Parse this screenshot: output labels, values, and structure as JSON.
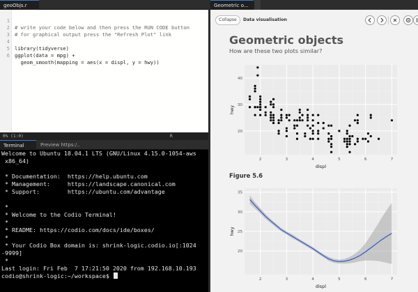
{
  "editor": {
    "tab_label": "geoObjs.r",
    "lines": [
      {
        "n": "1",
        "text": "# write your code below and then press the RUN CODE button",
        "type": "comment"
      },
      {
        "n": "2",
        "text": "# for graphical output press the \"Refresh Plot\" link",
        "type": "comment"
      },
      {
        "n": "3",
        "text": "",
        "type": "code"
      },
      {
        "n": "4",
        "text": "library(tidyverse)",
        "type": "code"
      },
      {
        "n": "5",
        "text": "ggplot(data = mpg) +",
        "type": "code"
      },
      {
        "n": "6",
        "text": "  geom_smooth(mapping = aes(x = displ, y = hwy))",
        "type": "code"
      }
    ],
    "status_left": "0% (1:0)",
    "status_lang": "R"
  },
  "terminal": {
    "tabs": [
      "Terminal",
      "Preview https:/..."
    ],
    "lines": [
      "Welcome to Ubuntu 18.04.1 LTS (GNU/Linux 4.15.0-1054-aws",
      " x86_64)",
      "",
      " * Documentation:  https://help.ubuntu.com",
      " * Management:     https://landscape.canonical.com",
      " * Support:        https://ubuntu.com/advantage",
      "",
      " *",
      " * Welcome to the Codio Terminal!",
      " *",
      " * README: https://codio.com/docs/ide/boxes/",
      " *",
      " * Your Codio Box domain is: shrink-logic.codio.io[:1024",
      "-9999]",
      " *",
      "Last login: Fri Feb  7 17:21:50 2020 from 192.168.10.193",
      "codio@shrink-logic:~/workspace$ "
    ]
  },
  "guide": {
    "tab_label": "Geometric o...",
    "collapse_label": "Collapse",
    "title": "Data visualisation",
    "prev_icon": "chevron-left-icon",
    "next_icon": "chevron-right-icon",
    "close_icon": "close-icon",
    "settings_icon": "gear-icon",
    "menu_icon": "hamburger-menu-icon",
    "heading": "Geometric objects",
    "subheading": "How are these two plots similar?",
    "figure_label": "Figure 5.6"
  },
  "chart_data": [
    {
      "type": "scatter",
      "xlabel": "displ",
      "ylabel": "hwy",
      "xlim": [
        1.4,
        7.2
      ],
      "ylim": [
        11,
        45
      ],
      "xticks": [
        2,
        3,
        4,
        5,
        6,
        7
      ],
      "yticks": [
        20,
        30,
        40
      ],
      "grid": true,
      "points": [
        [
          1.6,
          33
        ],
        [
          1.6,
          32
        ],
        [
          1.6,
          29
        ],
        [
          1.8,
          29
        ],
        [
          1.8,
          29
        ],
        [
          1.8,
          26
        ],
        [
          1.8,
          35
        ],
        [
          1.8,
          36
        ],
        [
          1.8,
          37
        ],
        [
          1.9,
          44
        ],
        [
          1.9,
          41
        ],
        [
          1.9,
          29
        ],
        [
          2.0,
          31
        ],
        [
          2.0,
          29
        ],
        [
          2.0,
          26
        ],
        [
          2.0,
          28
        ],
        [
          2.0,
          33
        ],
        [
          2.0,
          32
        ],
        [
          2.0,
          30
        ],
        [
          2.0,
          29
        ],
        [
          2.2,
          26
        ],
        [
          2.2,
          27
        ],
        [
          2.2,
          29
        ],
        [
          2.4,
          31
        ],
        [
          2.4,
          30
        ],
        [
          2.4,
          26
        ],
        [
          2.4,
          27
        ],
        [
          2.4,
          24
        ],
        [
          2.4,
          25
        ],
        [
          2.5,
          26
        ],
        [
          2.5,
          25
        ],
        [
          2.5,
          23
        ],
        [
          2.5,
          24
        ],
        [
          2.5,
          30
        ],
        [
          2.5,
          32
        ],
        [
          2.5,
          29
        ],
        [
          2.7,
          24
        ],
        [
          2.7,
          23
        ],
        [
          2.7,
          20
        ],
        [
          2.7,
          19
        ],
        [
          2.8,
          26
        ],
        [
          2.8,
          25
        ],
        [
          2.8,
          28
        ],
        [
          2.8,
          24
        ],
        [
          3.0,
          26
        ],
        [
          3.0,
          25
        ],
        [
          3.0,
          21
        ],
        [
          3.0,
          20
        ],
        [
          3.0,
          18
        ],
        [
          3.1,
          26
        ],
        [
          3.1,
          24
        ],
        [
          3.3,
          24
        ],
        [
          3.3,
          22
        ],
        [
          3.3,
          21
        ],
        [
          3.4,
          24
        ],
        [
          3.4,
          22
        ],
        [
          3.4,
          19
        ],
        [
          3.4,
          17
        ],
        [
          3.5,
          28
        ],
        [
          3.5,
          27
        ],
        [
          3.5,
          25
        ],
        [
          3.5,
          24
        ],
        [
          3.6,
          26
        ],
        [
          3.6,
          24
        ],
        [
          3.7,
          19
        ],
        [
          3.7,
          18
        ],
        [
          3.8,
          28
        ],
        [
          3.8,
          26
        ],
        [
          3.8,
          25
        ],
        [
          3.8,
          22
        ],
        [
          3.8,
          24
        ],
        [
          3.9,
          21
        ],
        [
          3.9,
          17
        ],
        [
          4.0,
          26
        ],
        [
          4.0,
          24
        ],
        [
          4.0,
          22
        ],
        [
          4.0,
          20
        ],
        [
          4.0,
          19
        ],
        [
          4.0,
          17
        ],
        [
          4.2,
          26
        ],
        [
          4.2,
          23
        ],
        [
          4.2,
          20
        ],
        [
          4.2,
          19
        ],
        [
          4.2,
          17
        ],
        [
          4.4,
          23
        ],
        [
          4.4,
          21
        ],
        [
          4.6,
          22
        ],
        [
          4.6,
          19
        ],
        [
          4.6,
          17
        ],
        [
          4.6,
          16
        ],
        [
          4.7,
          22
        ],
        [
          4.7,
          18
        ],
        [
          4.7,
          17
        ],
        [
          4.7,
          15
        ],
        [
          4.7,
          12
        ],
        [
          4.7,
          14
        ],
        [
          5.0,
          20
        ],
        [
          5.2,
          17
        ],
        [
          5.2,
          16
        ],
        [
          5.3,
          17
        ],
        [
          5.3,
          16
        ],
        [
          5.3,
          15
        ],
        [
          5.3,
          14
        ],
        [
          5.3,
          19
        ],
        [
          5.3,
          20
        ],
        [
          5.4,
          18
        ],
        [
          5.4,
          17
        ],
        [
          5.4,
          15
        ],
        [
          5.4,
          16
        ],
        [
          5.4,
          22
        ],
        [
          5.4,
          12
        ],
        [
          5.5,
          18
        ],
        [
          5.6,
          15
        ],
        [
          5.6,
          24
        ],
        [
          5.7,
          26
        ],
        [
          5.7,
          24
        ],
        [
          5.7,
          23
        ],
        [
          5.7,
          16
        ],
        [
          5.7,
          17
        ],
        [
          5.9,
          17
        ],
        [
          6.0,
          17
        ],
        [
          6.1,
          16
        ],
        [
          6.1,
          19
        ],
        [
          6.2,
          26
        ],
        [
          6.2,
          25
        ],
        [
          6.2,
          18
        ],
        [
          6.5,
          17
        ],
        [
          7.0,
          24
        ]
      ]
    },
    {
      "type": "line",
      "xlabel": "displ",
      "ylabel": "hwy",
      "xlim": [
        1.4,
        7.2
      ],
      "ylim": [
        14,
        36
      ],
      "xticks": [
        2,
        3,
        4,
        5,
        6,
        7
      ],
      "yticks": [
        20,
        25,
        30,
        35
      ],
      "grid": true,
      "x": [
        1.6,
        1.8,
        2.0,
        2.2,
        2.4,
        2.6,
        2.8,
        3.0,
        3.2,
        3.4,
        3.6,
        3.8,
        4.0,
        4.2,
        4.4,
        4.6,
        4.8,
        5.0,
        5.2,
        5.4,
        5.6,
        5.8,
        6.0,
        6.2,
        6.4,
        6.6,
        6.8,
        7.0
      ],
      "y": [
        33.1,
        31.6,
        30.2,
        28.8,
        27.6,
        26.5,
        25.4,
        24.6,
        23.8,
        23.0,
        22.2,
        21.4,
        20.6,
        19.7,
        18.8,
        18.0,
        17.5,
        17.3,
        17.4,
        17.7,
        18.2,
        18.9,
        19.8,
        20.8,
        21.8,
        22.8,
        23.7,
        24.5
      ],
      "lower": [
        32.0,
        30.8,
        29.5,
        28.2,
        27.1,
        26.0,
        25.0,
        24.2,
        23.3,
        22.6,
        21.8,
        21.0,
        20.2,
        19.3,
        18.4,
        17.5,
        17.0,
        16.8,
        16.8,
        16.9,
        17.1,
        17.4,
        17.6,
        17.6,
        17.5,
        17.3,
        17.0,
        16.7
      ],
      "upper": [
        34.2,
        32.4,
        30.9,
        29.4,
        28.1,
        27.0,
        25.8,
        25.0,
        24.3,
        23.4,
        22.6,
        21.8,
        21.0,
        20.1,
        19.2,
        18.5,
        18.0,
        17.8,
        18.0,
        18.5,
        19.3,
        20.4,
        22.0,
        24.0,
        26.1,
        28.3,
        30.4,
        32.3
      ],
      "line_color": "#3a5fcd",
      "band_color": "#999999"
    }
  ]
}
